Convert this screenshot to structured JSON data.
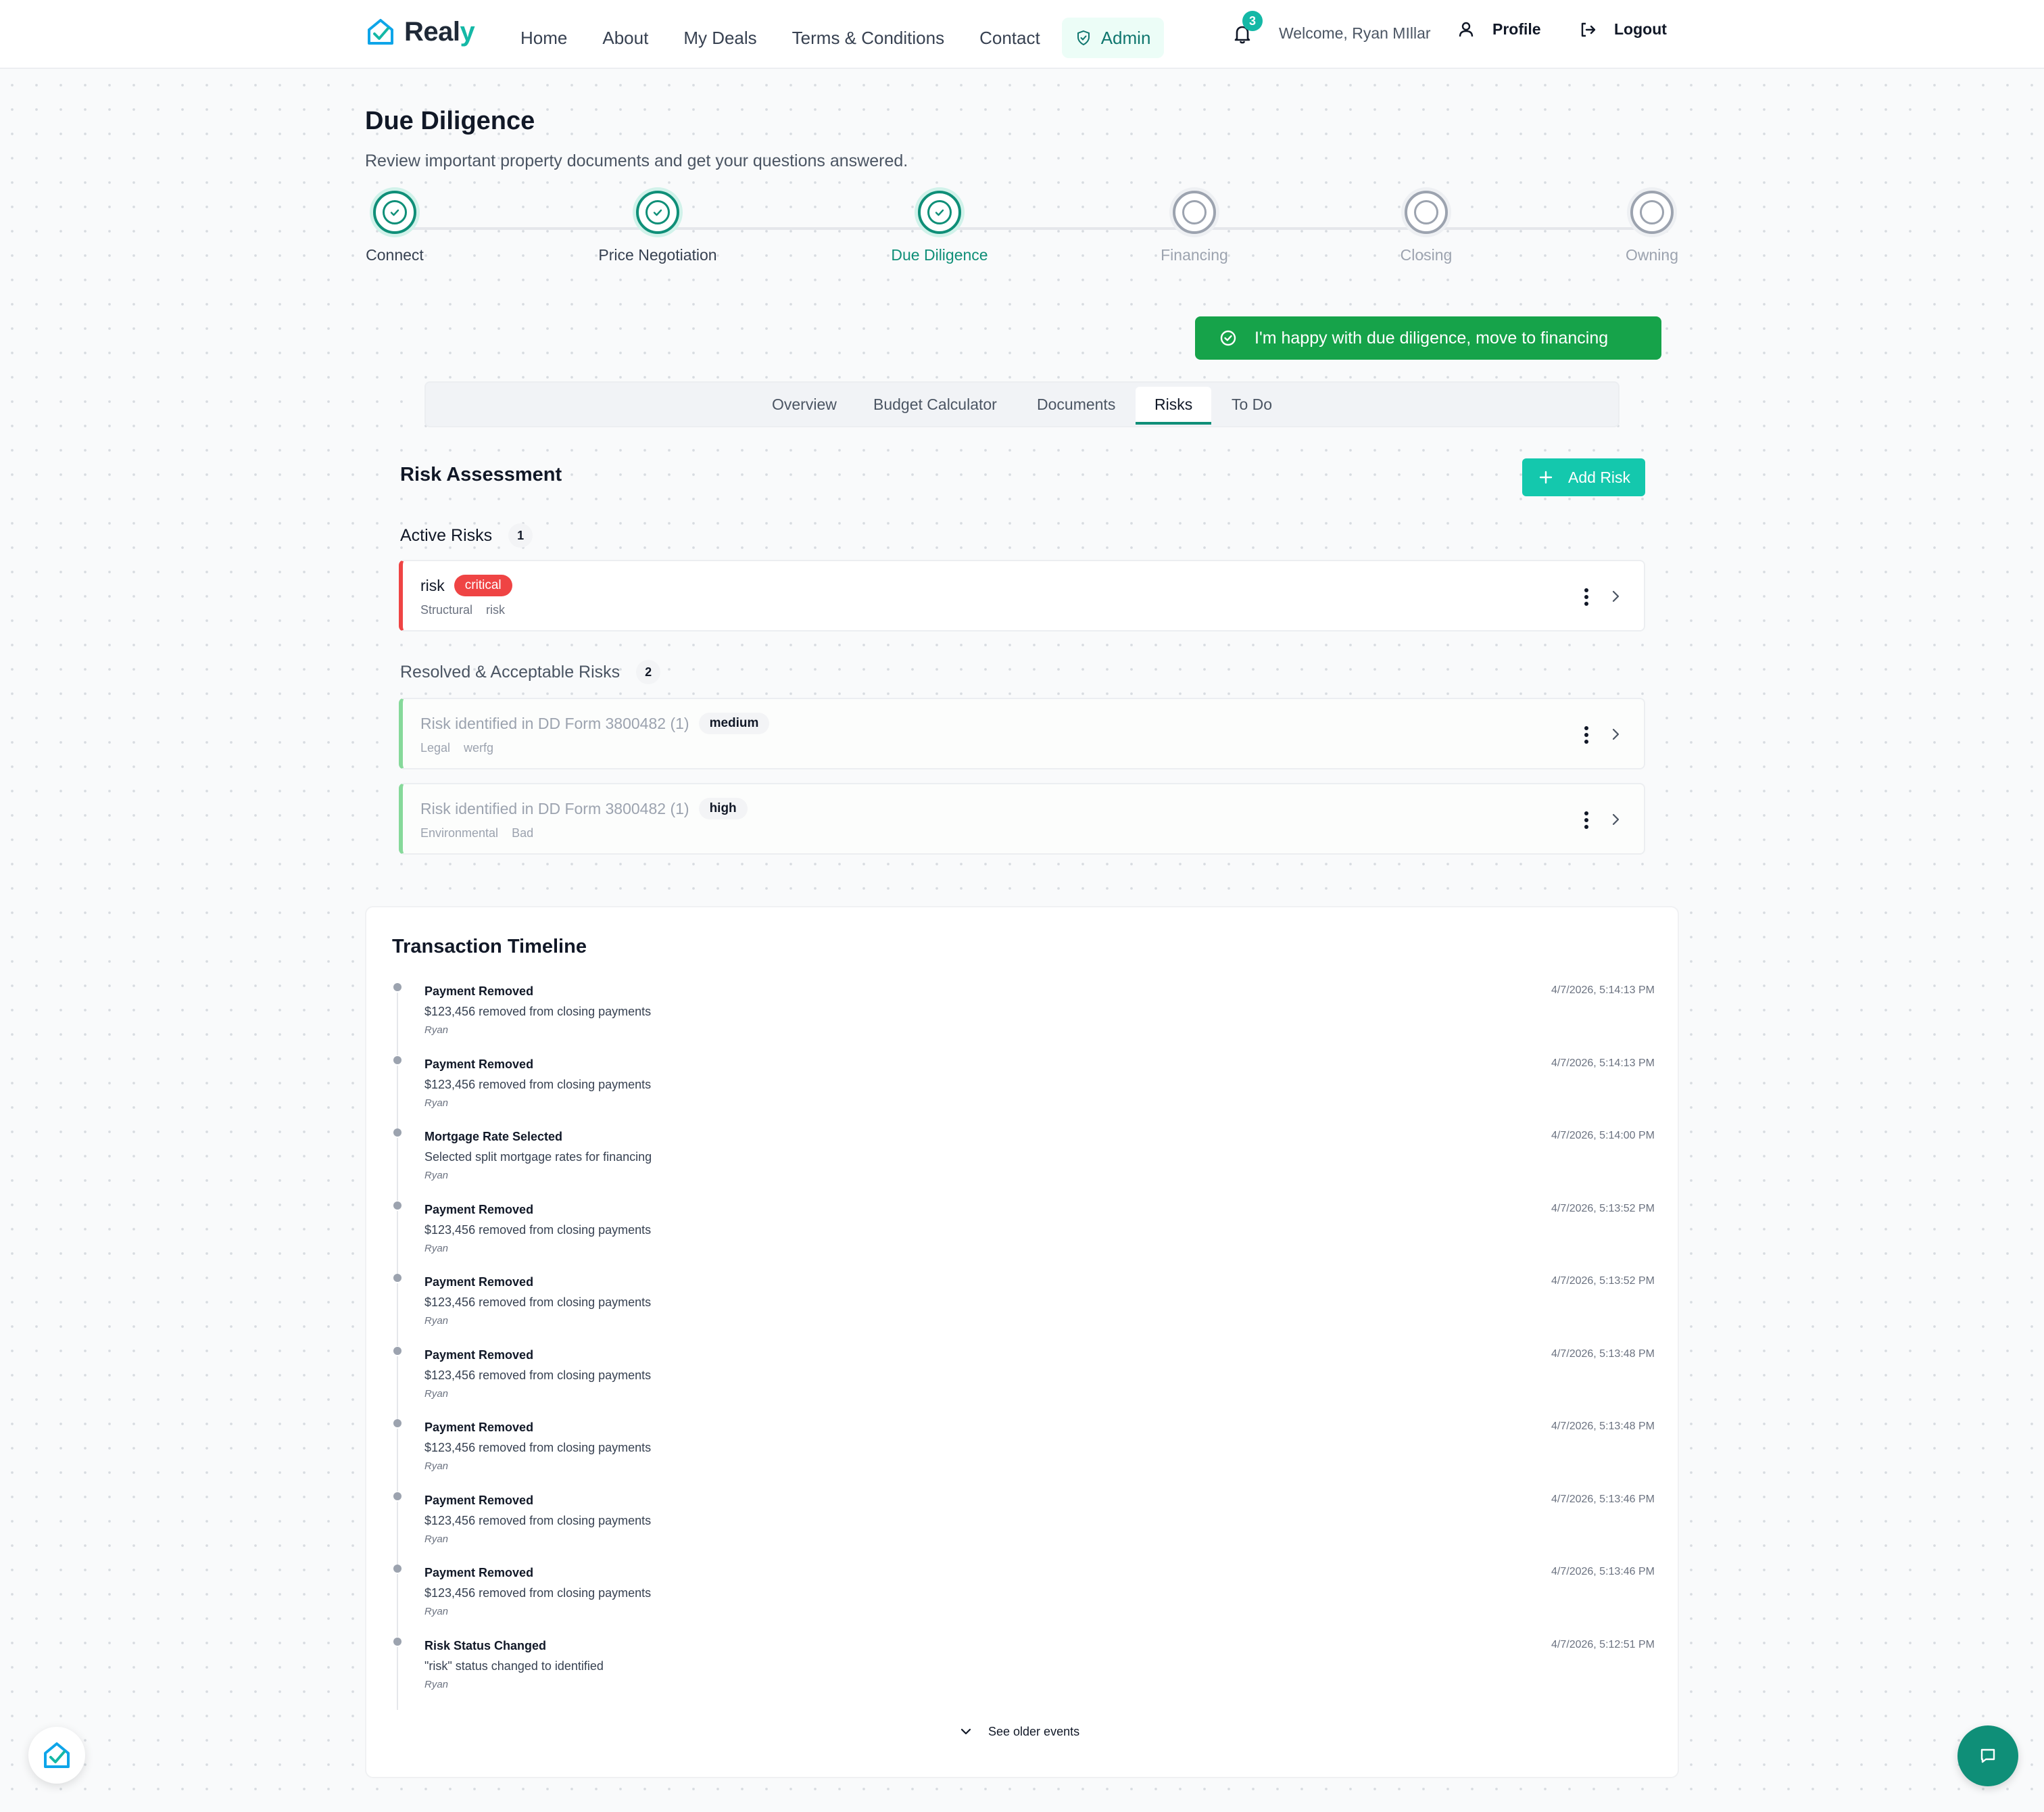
{
  "nav": {
    "brand": "Realy",
    "links": [
      "Home",
      "About",
      "My Deals",
      "Terms & Conditions",
      "Contact"
    ],
    "admin_label": "Admin",
    "notification_count": "3",
    "welcome": "Welcome, Ryan MIllar",
    "profile_label": "Profile",
    "logout_label": "Logout"
  },
  "page": {
    "title": "Due Diligence",
    "subtitle": "Review important property documents and get your questions answered."
  },
  "stepper": {
    "steps": [
      {
        "label": "Connect",
        "state": "completed"
      },
      {
        "label": "Price Negotiation",
        "state": "completed"
      },
      {
        "label": "Due Diligence",
        "state": "current"
      },
      {
        "label": "Financing",
        "state": "pending"
      },
      {
        "label": "Closing",
        "state": "pending"
      },
      {
        "label": "Owning",
        "state": "pending"
      }
    ]
  },
  "proceed_button": "I'm happy with due diligence, move to financing",
  "tabs": [
    "Overview",
    "Budget Calculator",
    "Documents",
    "Risks",
    "To Do"
  ],
  "active_tab": "Risks",
  "risks": {
    "title": "Risk Assessment",
    "add_label": "Add Risk",
    "active_heading": "Active Risks",
    "active_count": "1",
    "active": [
      {
        "name": "risk",
        "severity": "critical",
        "category": "Structural",
        "note": "risk"
      }
    ],
    "resolved_heading": "Resolved & Acceptable Risks",
    "resolved_count": "2",
    "resolved": [
      {
        "name": "Risk identified in DD Form 3800482 (1)",
        "severity": "medium",
        "category": "Legal",
        "note": "werfg"
      },
      {
        "name": "Risk identified in DD Form 3800482 (1)",
        "severity": "high",
        "category": "Environmental",
        "note": "Bad"
      }
    ]
  },
  "timeline": {
    "title": "Transaction Timeline",
    "events": [
      {
        "title": "Payment Removed",
        "desc": "$123,456 removed from closing payments",
        "user": "Ryan",
        "time": "4/7/2026, 5:14:13 PM"
      },
      {
        "title": "Payment Removed",
        "desc": "$123,456 removed from closing payments",
        "user": "Ryan",
        "time": "4/7/2026, 5:14:13 PM"
      },
      {
        "title": "Mortgage Rate Selected",
        "desc": "Selected split mortgage rates for financing",
        "user": "Ryan",
        "time": "4/7/2026, 5:14:00 PM"
      },
      {
        "title": "Payment Removed",
        "desc": "$123,456 removed from closing payments",
        "user": "Ryan",
        "time": "4/7/2026, 5:13:52 PM"
      },
      {
        "title": "Payment Removed",
        "desc": "$123,456 removed from closing payments",
        "user": "Ryan",
        "time": "4/7/2026, 5:13:52 PM"
      },
      {
        "title": "Payment Removed",
        "desc": "$123,456 removed from closing payments",
        "user": "Ryan",
        "time": "4/7/2026, 5:13:48 PM"
      },
      {
        "title": "Payment Removed",
        "desc": "$123,456 removed from closing payments",
        "user": "Ryan",
        "time": "4/7/2026, 5:13:48 PM"
      },
      {
        "title": "Payment Removed",
        "desc": "$123,456 removed from closing payments",
        "user": "Ryan",
        "time": "4/7/2026, 5:13:46 PM"
      },
      {
        "title": "Payment Removed",
        "desc": "$123,456 removed from closing payments",
        "user": "Ryan",
        "time": "4/7/2026, 5:13:46 PM"
      },
      {
        "title": "Risk Status Changed",
        "desc": "\"risk\" status changed to identified",
        "user": "Ryan",
        "time": "4/7/2026, 5:12:51 PM"
      }
    ],
    "older_label": "See older events"
  },
  "colors": {
    "brand_teal": "#14b8a6",
    "primary_green": "#16a34a",
    "step_green": "#0f8f78",
    "critical_red": "#ef4444"
  },
  "icons": [
    "house-check-icon",
    "shield-icon",
    "bell-icon",
    "user-icon",
    "logout-icon",
    "check-circle-icon",
    "plus-icon",
    "kebab-icon",
    "chevron-right-icon",
    "chevron-down-icon",
    "chat-icon"
  ]
}
